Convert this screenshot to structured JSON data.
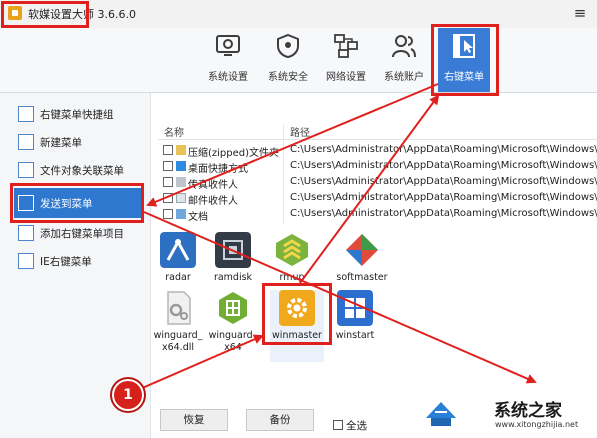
{
  "window": {
    "title": "软媒设置大师 3.6.6.0",
    "menu_icon": "hamburger-icon"
  },
  "toolbar": {
    "items": [
      {
        "label": "系统设置",
        "icon": "monitor-gear-icon"
      },
      {
        "label": "系统安全",
        "icon": "shield-icon"
      },
      {
        "label": "网络设置",
        "icon": "network-icon"
      },
      {
        "label": "系统账户",
        "icon": "users-icon"
      },
      {
        "label": "右键菜单",
        "icon": "cursor-menu-icon",
        "active": true
      }
    ]
  },
  "sidebar": {
    "items": [
      {
        "label": "右键菜单快捷组"
      },
      {
        "label": "新建菜单"
      },
      {
        "label": "文件对象关联菜单"
      },
      {
        "label": "发送到菜单",
        "active": true
      },
      {
        "label": "添加右键菜单项目"
      },
      {
        "label": "IE右键菜单"
      }
    ]
  },
  "list": {
    "headers": {
      "name": "名称",
      "path": "路径"
    },
    "rows": [
      {
        "name": "压缩(zipped)文件夹",
        "path": "C:\\Users\\Administrator\\AppData\\Roaming\\Microsoft\\Windows\\Ser"
      },
      {
        "name": "桌面快捷方式",
        "path": "C:\\Users\\Administrator\\AppData\\Roaming\\Microsoft\\Windows\\Ser"
      },
      {
        "name": "传真收件人",
        "path": "C:\\Users\\Administrator\\AppData\\Roaming\\Microsoft\\Windows\\Ser"
      },
      {
        "name": "邮件收件人",
        "path": "C:\\Users\\Administrator\\AppData\\Roaming\\Microsoft\\Windows\\Ser"
      },
      {
        "name": "文档",
        "path": "C:\\Users\\Administrator\\AppData\\Roaming\\Microsoft\\Windows\\Ser"
      }
    ]
  },
  "grid": {
    "items": [
      {
        "label": "radar",
        "icon": "radar-icon"
      },
      {
        "label": "ramdisk",
        "icon": "chip-icon"
      },
      {
        "label": "rmup",
        "icon": "layers-icon"
      },
      {
        "label": "softmaster",
        "icon": "softmaster-icon"
      },
      {
        "label": "winguard_ x64.dll",
        "icon": "dll-file-icon"
      },
      {
        "label": "winguard_ x64",
        "icon": "winguard-icon"
      },
      {
        "label": "winmaster",
        "icon": "gear-icon"
      },
      {
        "label": "winstart",
        "icon": "windows-icon"
      }
    ]
  },
  "buttons": {
    "restore": "恢复",
    "backup": "备份",
    "select_all": "全选"
  },
  "annotation": {
    "step_number": "1"
  },
  "watermark": {
    "text": "系统之家",
    "url": "www.xitongzhijia.net"
  },
  "colors": {
    "accent": "#2f78d0",
    "annotation_red": "#e0201c"
  }
}
